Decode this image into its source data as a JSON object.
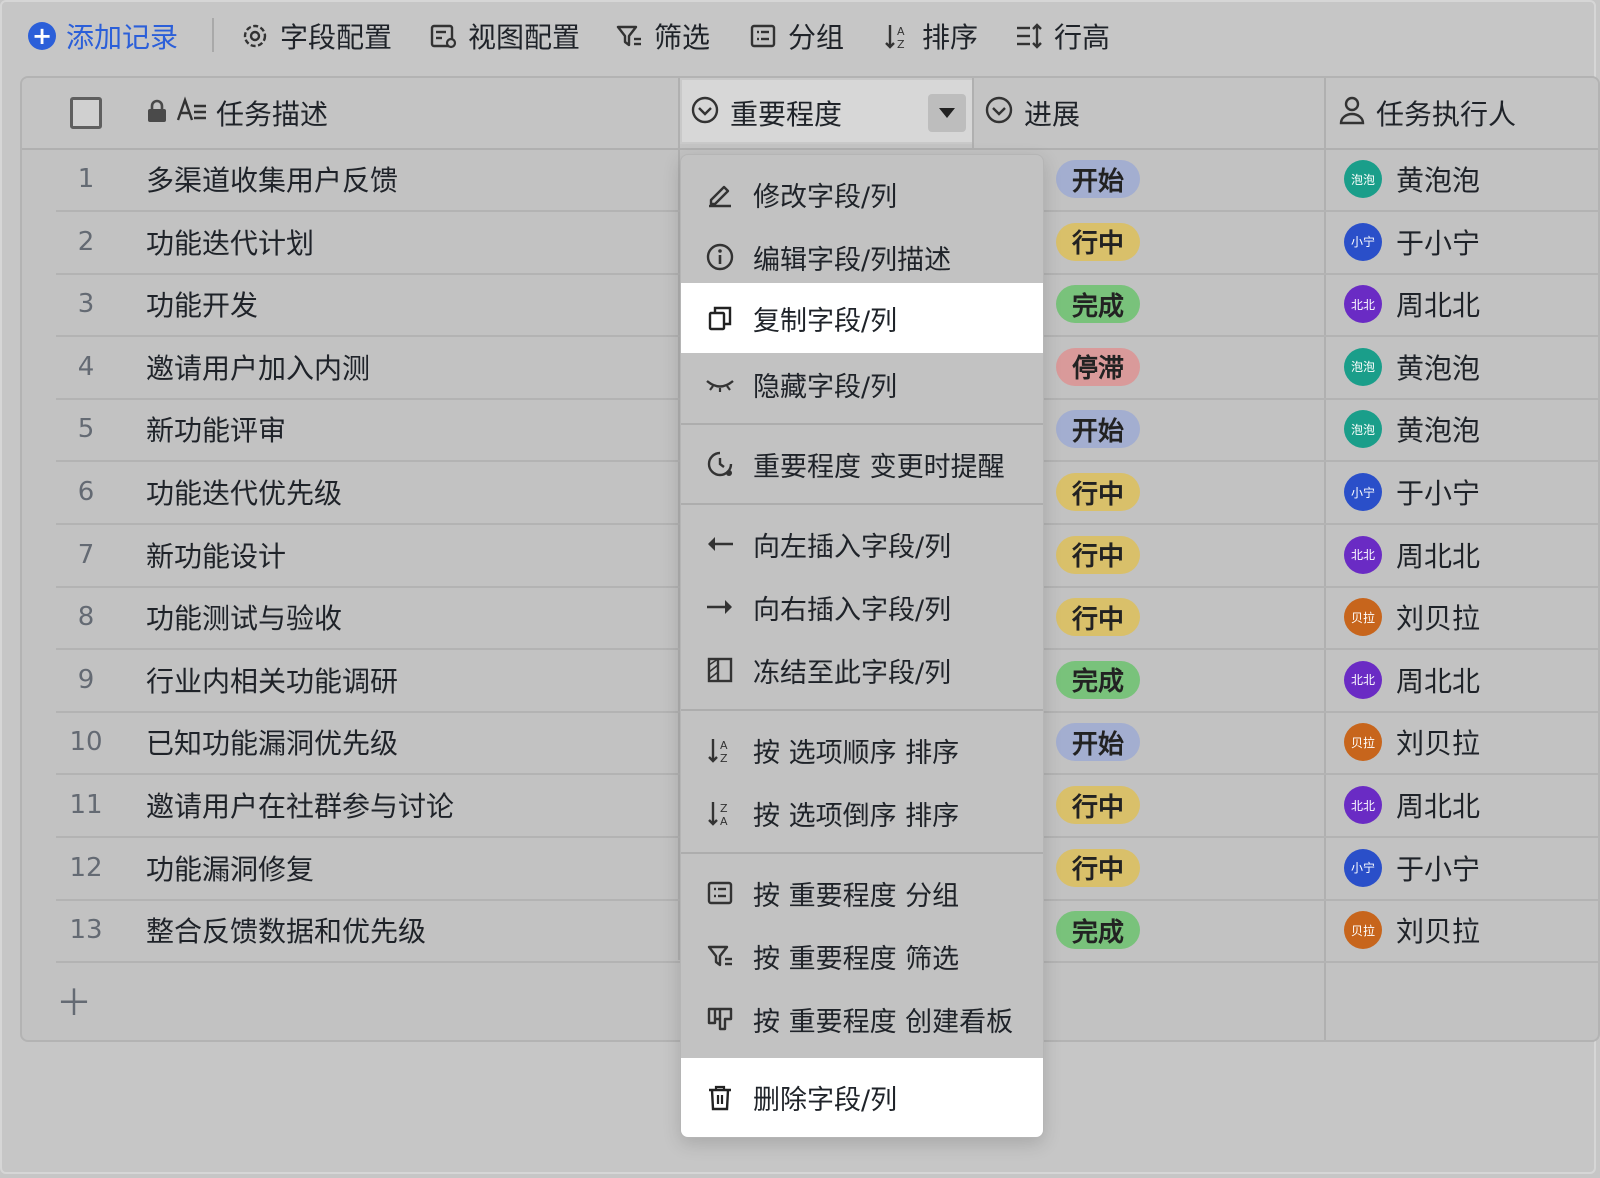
{
  "toolbar": {
    "add_record": "添加记录",
    "field_config": "字段配置",
    "view_config": "视图配置",
    "filter": "筛选",
    "group": "分组",
    "sort": "排序",
    "row_height": "行高"
  },
  "columns": {
    "task": "任务描述",
    "importance": "重要程度",
    "progress": "进展",
    "assignee": "任务执行人"
  },
  "rows": [
    {
      "num": "1",
      "task": "多渠道收集用户反馈",
      "progress": "开始",
      "assignee": "黄泡泡",
      "avatar": "泡泡"
    },
    {
      "num": "2",
      "task": "功能迭代计划",
      "progress": "行中",
      "assignee": "于小宁",
      "avatar": "小宁"
    },
    {
      "num": "3",
      "task": "功能开发",
      "progress": "完成",
      "assignee": "周北北",
      "avatar": "北北"
    },
    {
      "num": "4",
      "task": "邀请用户加入内测",
      "progress": "停滞",
      "assignee": "黄泡泡",
      "avatar": "泡泡"
    },
    {
      "num": "5",
      "task": "新功能评审",
      "progress": "开始",
      "assignee": "黄泡泡",
      "avatar": "泡泡"
    },
    {
      "num": "6",
      "task": "功能迭代优先级",
      "progress": "行中",
      "assignee": "于小宁",
      "avatar": "小宁"
    },
    {
      "num": "7",
      "task": "新功能设计",
      "progress": "行中",
      "assignee": "周北北",
      "avatar": "北北"
    },
    {
      "num": "8",
      "task": "功能测试与验收",
      "progress": "行中",
      "assignee": "刘贝拉",
      "avatar": "贝拉"
    },
    {
      "num": "9",
      "task": "行业内相关功能调研",
      "progress": "完成",
      "assignee": "周北北",
      "avatar": "北北"
    },
    {
      "num": "10",
      "task": "已知功能漏洞优先级",
      "progress": "开始",
      "assignee": "刘贝拉",
      "avatar": "贝拉"
    },
    {
      "num": "11",
      "task": "邀请用户在社群参与讨论",
      "progress": "行中",
      "assignee": "周北北",
      "avatar": "北北"
    },
    {
      "num": "12",
      "task": "功能漏洞修复",
      "progress": "行中",
      "assignee": "于小宁",
      "avatar": "小宁"
    },
    {
      "num": "13",
      "task": "整合反馈数据和优先级",
      "progress": "完成",
      "assignee": "刘贝拉",
      "avatar": "贝拉"
    }
  ],
  "colors": {
    "tag_start": "#a3aed0",
    "tag_doing": "#d9c06a",
    "tag_done": "#79c27b",
    "tag_stalled": "#d99a9a",
    "avatar_huang": "#1a9e8a",
    "avatar_yu": "#2a4fc9",
    "avatar_zhou": "#6a2bc4",
    "avatar_liu": "#c7651c"
  },
  "menu": {
    "edit_field": "修改字段/列",
    "edit_desc": "编辑字段/列描述",
    "copy_field": "复制字段/列",
    "hide_field": "隐藏字段/列",
    "remind": "重要程度 变更时提醒",
    "insert_left": "向左插入字段/列",
    "insert_right": "向右插入字段/列",
    "freeze": "冻结至此字段/列",
    "sort_asc": "按 选项顺序 排序",
    "sort_desc": "按 选项倒序 排序",
    "group_by": "按 重要程度 分组",
    "filter_by": "按 重要程度 筛选",
    "kanban": "按 重要程度 创建看板",
    "delete_field": "删除字段/列"
  }
}
